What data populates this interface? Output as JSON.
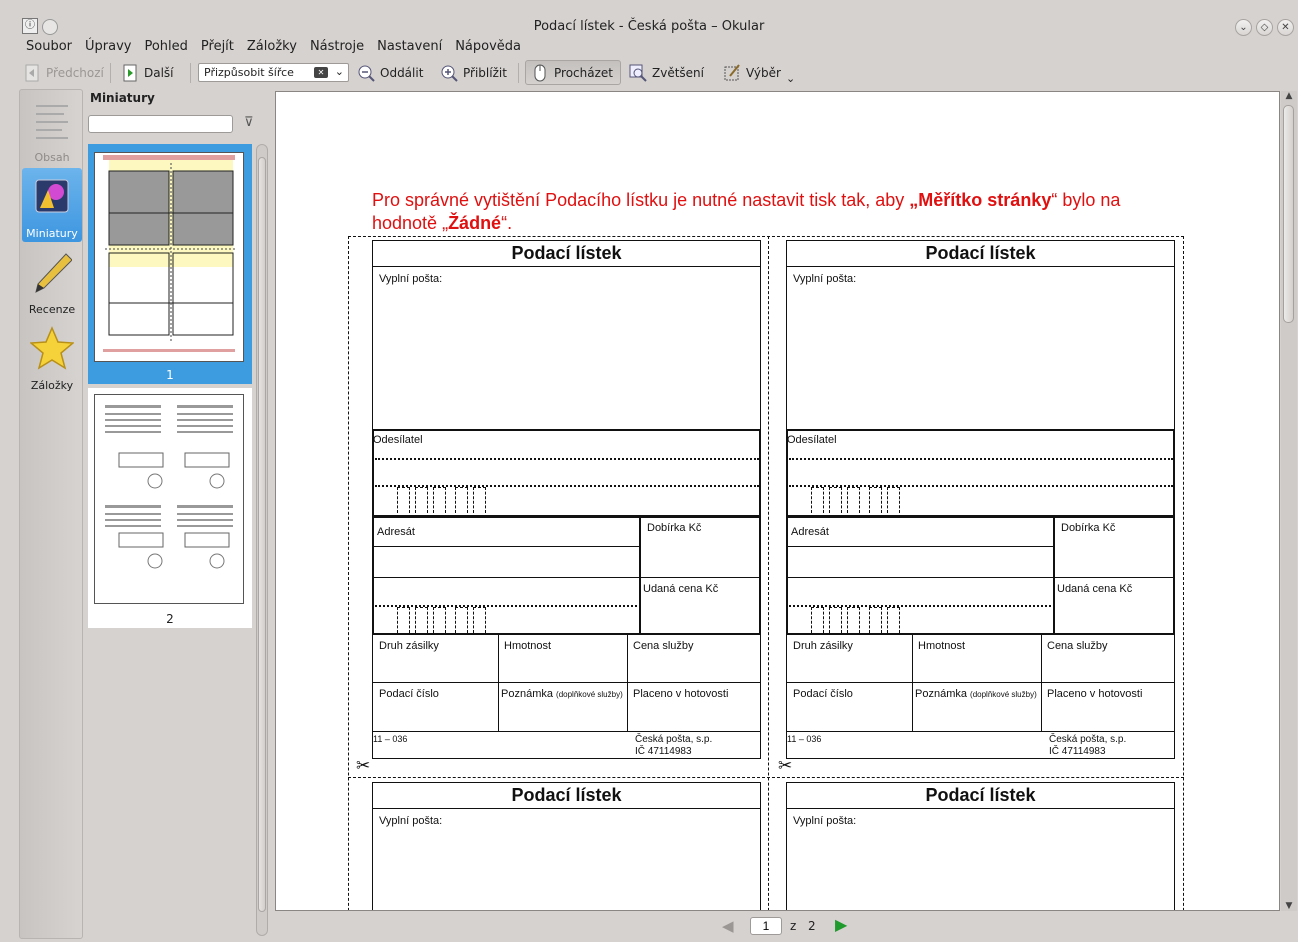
{
  "window": {
    "title": "Podací lístek - Česká pošta – Okular"
  },
  "menu": [
    "Soubor",
    "Úpravy",
    "Pohled",
    "Přejít",
    "Záložky",
    "Nástroje",
    "Nastavení",
    "Nápověda"
  ],
  "toolbar": {
    "prev": "Předchozí",
    "next": "Další",
    "zoom_value": "Přizpůsobit šířce",
    "zoom_out": "Oddálit",
    "zoom_in": "Přiblížit",
    "browse": "Procházet",
    "magnify": "Zvětšení",
    "select": "Výběr"
  },
  "sidebar": {
    "items": [
      {
        "label": "Obsah",
        "icon": "contents-icon"
      },
      {
        "label": "Miniatury",
        "icon": "thumbnails-icon"
      },
      {
        "label": "Recenze",
        "icon": "pencil-icon"
      },
      {
        "label": "Záložky",
        "icon": "star-icon"
      }
    ]
  },
  "thumbnails": {
    "header": "Miniatury",
    "search_value": "",
    "pages": [
      "1",
      "2"
    ]
  },
  "document": {
    "notice_part1": "Pro správné vytištění Podacího lístku je nutné nastavit tisk tak, aby ",
    "notice_bold1": "„Měřítko stránky",
    "notice_part2": "“ bylo na hodnotě „",
    "notice_bold2": "Žádné",
    "notice_part3": "“.",
    "form": {
      "title": "Podací lístek",
      "vyplni": "Vyplní pošta:",
      "odesilatel": "Odesílatel",
      "adresat": "Adresát",
      "dobirka": "Dobírka Kč",
      "udana": "Udaná cena Kč",
      "druh": "Druh zásilky",
      "hmotnost": "Hmotnost",
      "cena": "Cena služby",
      "podaci_cislo": "Podací číslo",
      "poznamka": "Poznámka",
      "poznamka_small": "(doplňkové služby)",
      "placeno": "Placeno v hotovosti",
      "code": "11 – 036",
      "company1": "Česká pošta, s.p.",
      "company2": "IČ 47114983"
    }
  },
  "pagenav": {
    "current": "1",
    "of": "z",
    "total": "2"
  }
}
